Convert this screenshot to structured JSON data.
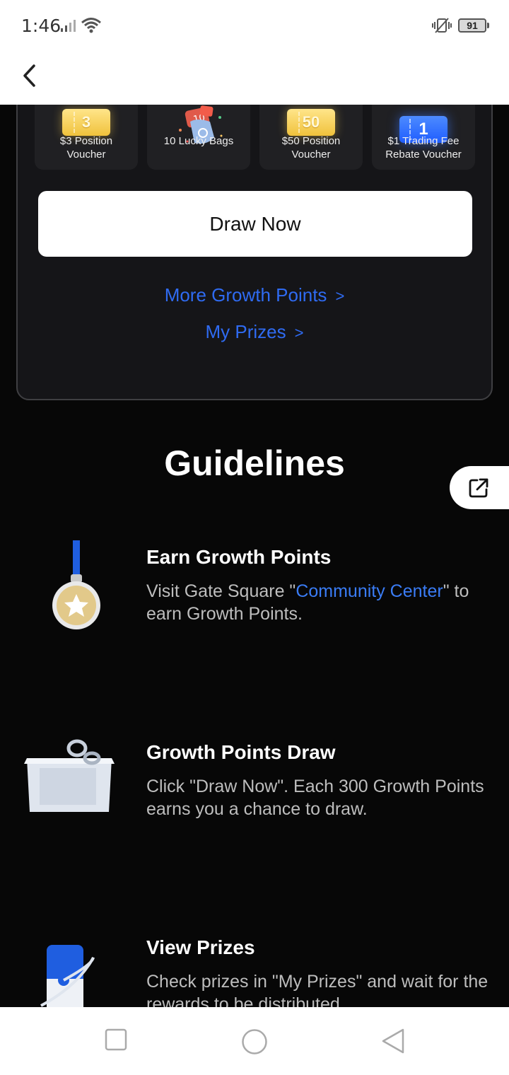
{
  "status_bar": {
    "time": "1:46",
    "battery": "91"
  },
  "prizes": [
    {
      "label": "$3 Position Voucher",
      "badge": "3",
      "icon": "gold-voucher-icon"
    },
    {
      "label": "10 Lucky Bags",
      "badge": "10",
      "icon": "lucky-bag-icon"
    },
    {
      "label": "$50 Position Voucher",
      "badge": "50",
      "icon": "gold-voucher-icon"
    },
    {
      "label": "$1 Trading Fee Rebate Voucher",
      "badge": "1",
      "icon": "blue-voucher-icon"
    }
  ],
  "draw_button": "Draw Now",
  "links": {
    "more_points": "More Growth Points",
    "my_prizes": "My Prizes",
    "chevron": ">"
  },
  "guidelines": {
    "title": "Guidelines",
    "steps": [
      {
        "heading": "Earn Growth Points",
        "text_before": "Visit Gate Square \"",
        "highlight": "Community Center",
        "text_after": "\" to earn Growth Points.",
        "icon": "medal-icon"
      },
      {
        "heading": "Growth Points Draw",
        "text": "Click \"Draw Now\". Each 300 Growth Points earns you a chance to draw.",
        "icon": "draw-box-icon"
      },
      {
        "heading": "View Prizes",
        "text": "Check prizes in \"My Prizes\" and wait for the rewards to be distributed.",
        "icon": "prize-tag-icon"
      }
    ]
  },
  "colors": {
    "accent": "#2f6bf2",
    "background": "#070707",
    "card": "#151518"
  }
}
